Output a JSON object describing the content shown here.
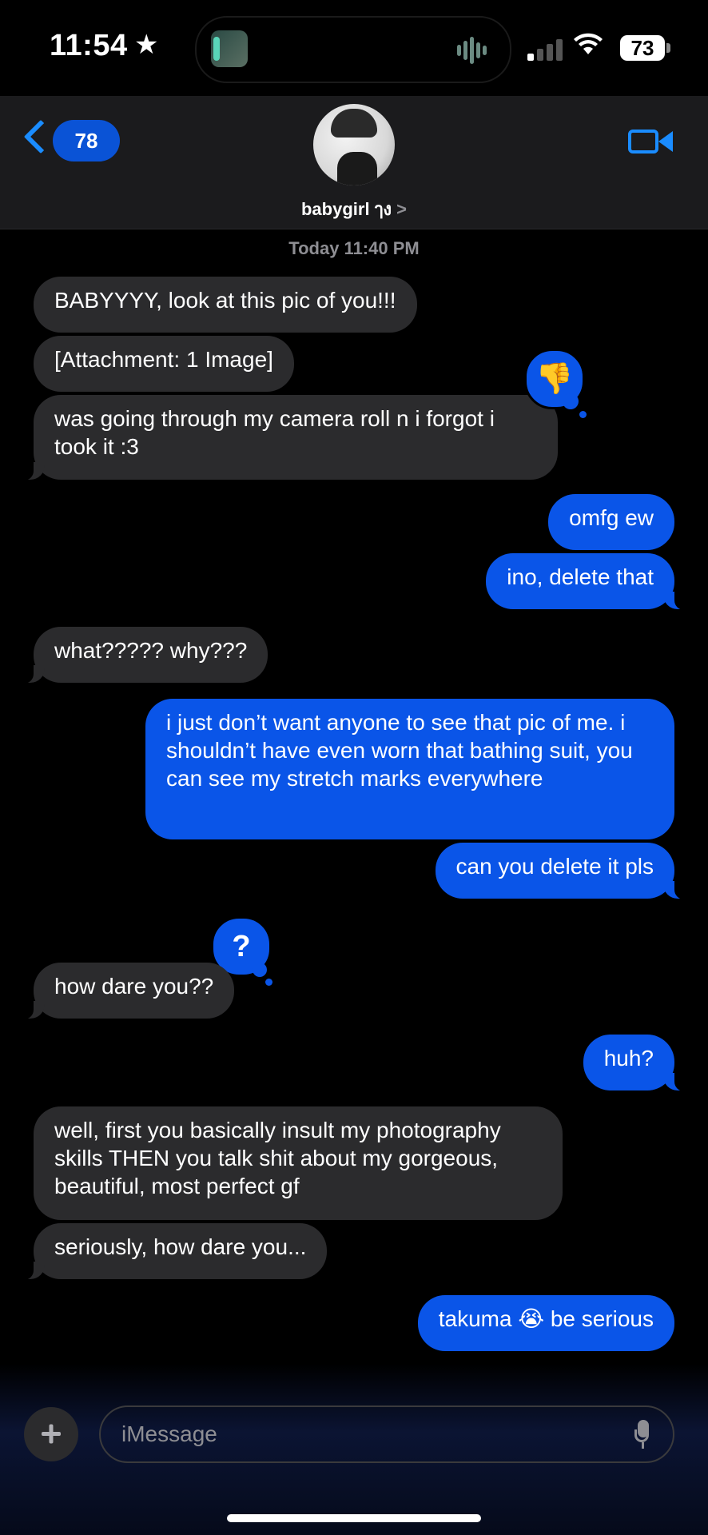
{
  "status_bar": {
    "time": "11:54",
    "star": "★",
    "battery": "73",
    "icons": [
      "focus-star-icon",
      "live-activity-icon",
      "audio-waveform-icon",
      "cellular-signal-icon",
      "wifi-icon",
      "battery-icon"
    ]
  },
  "header": {
    "back_badge": "78",
    "contact_name": "babygirl ๅง",
    "contact_chevron": ">",
    "icons": [
      "back-chevron-icon",
      "contact-avatar",
      "video-camera-icon"
    ]
  },
  "conversation": {
    "timestamp": "Today 11:40 PM",
    "messages": [
      {
        "from": "them",
        "text": "BABYYYY, look at this pic of you!!!"
      },
      {
        "from": "them",
        "text": "[Attachment: 1 Image]"
      },
      {
        "from": "them",
        "text": "was going through my camera roll n i forgot i took it :3",
        "tapback": "thumbs-down"
      },
      {
        "from": "me",
        "text": "omfg ew"
      },
      {
        "from": "me",
        "text": "ino, delete that"
      },
      {
        "from": "them",
        "text": "what????? why???"
      },
      {
        "from": "me",
        "text": "i just don’t want anyone to see that pic of me. i shouldn’t have even worn that bathing suit, you can see my stretch marks everywhere"
      },
      {
        "from": "me",
        "text": "can you delete it pls"
      },
      {
        "from": "them",
        "text": "how dare you??",
        "tapback": "question"
      },
      {
        "from": "me",
        "text": "huh?"
      },
      {
        "from": "them",
        "text": "well, first you basically insult my photography skills THEN you talk shit about my gorgeous, beautiful, most perfect gf"
      },
      {
        "from": "them",
        "text": "seriously, how dare you..."
      },
      {
        "from": "me",
        "text": "takuma 😭 be serious"
      }
    ],
    "tapback_glyphs": {
      "question": "?",
      "thumbs-down": "👎"
    }
  },
  "composer": {
    "placeholder": "iMessage",
    "icons": [
      "plus-icon",
      "microphone-icon"
    ]
  },
  "colors": {
    "sent_bubble": "#0a55e8",
    "received_bubble": "#2b2b2d",
    "accent": "#1a8cff",
    "background": "#000000"
  }
}
